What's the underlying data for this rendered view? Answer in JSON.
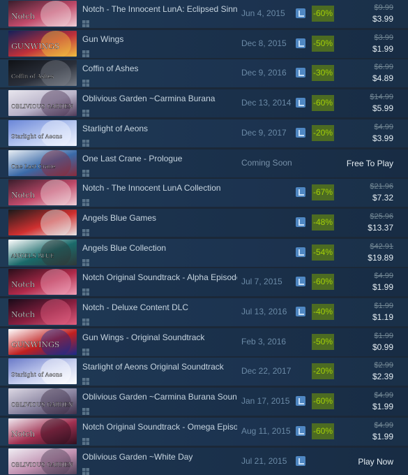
{
  "colors": {
    "background": "#1b2838",
    "discount_bg": "#4c6b22",
    "discount_text": "#a4d007",
    "wishlist_badge": "#4f87c2"
  },
  "rows": [
    {
      "title": "Notch - The Innocent LunA: Eclipsed Sinn...",
      "date": "Jun 4, 2015",
      "discount": "-60%",
      "original_price": "$9.99",
      "final_price": "$3.99",
      "capsule_text": "Notch",
      "capsule_colors": [
        "#3a1d2c",
        "#c04a6a",
        "#f0d0d8"
      ],
      "wishlist": true
    },
    {
      "title": "Gun Wings",
      "date": "Dec 8, 2015",
      "discount": "-50%",
      "original_price": "$3.99",
      "final_price": "$1.99",
      "capsule_text": "GUNWINGS",
      "capsule_colors": [
        "#14205a",
        "#c0303a",
        "#f0c040"
      ],
      "wishlist": true
    },
    {
      "title": "Coffin of Ashes",
      "date": "Dec 9, 2016",
      "discount": "-30%",
      "original_price": "$6.99",
      "final_price": "$4.89",
      "capsule_text": "Coffin of Ashes",
      "capsule_colors": [
        "#101216",
        "#2a2f3a",
        "#7a7f88"
      ],
      "wishlist": true
    },
    {
      "title": "Oblivious Garden ~Carmina Burana",
      "date": "Dec 13, 2014",
      "discount": "-60%",
      "original_price": "$14.99",
      "final_price": "$5.99",
      "capsule_text": "OBLIVIOUS GARDEN",
      "capsule_colors": [
        "#e8e6ee",
        "#b8b2c8",
        "#503a58"
      ],
      "wishlist": true
    },
    {
      "title": "Starlight of Aeons",
      "date": "Dec 9, 2017",
      "discount": "-20%",
      "original_price": "$4.99",
      "final_price": "$3.99",
      "capsule_text": "Starlight of Aeons",
      "capsule_colors": [
        "#6a86d8",
        "#b8c8f0",
        "#f0f4ff"
      ],
      "wishlist": true
    },
    {
      "title": "One Last Crane - Prologue",
      "date": "Coming Soon",
      "discount": "",
      "original_price": "",
      "final_price": "Free To Play",
      "capsule_text": "One Last Crane",
      "capsule_colors": [
        "#e8eef4",
        "#3a6aa8",
        "#8a2a3a"
      ],
      "wishlist": false
    },
    {
      "title": "Notch - The Innocent LunA Collection",
      "date": "",
      "discount": "-67%",
      "original_price": "$21.96",
      "final_price": "$7.32",
      "capsule_text": "Notch",
      "capsule_colors": [
        "#3a1d2c",
        "#c04a6a",
        "#f0d0d8"
      ],
      "wishlist": true
    },
    {
      "title": "Angels Blue Games",
      "date": "",
      "discount": "-48%",
      "original_price": "$25.96",
      "final_price": "$13.37",
      "capsule_text": "",
      "capsule_colors": [
        "#1a1a1a",
        "#d03030",
        "#e8e8e8"
      ],
      "wishlist": true
    },
    {
      "title": "Angels Blue Collection",
      "date": "",
      "discount": "-54%",
      "original_price": "$42.91",
      "final_price": "$19.89",
      "capsule_text": "ANGELS BLUE",
      "capsule_colors": [
        "#ffffff",
        "#1a6a6a",
        "#303838"
      ],
      "wishlist": true
    },
    {
      "title": "Notch Original Soundtrack - Alpha Episode",
      "date": "Jul 7, 2015",
      "discount": "-60%",
      "original_price": "$4.99",
      "final_price": "$1.99",
      "capsule_text": "Notch",
      "capsule_colors": [
        "#2a0e1a",
        "#b02a4a",
        "#f0a0b8"
      ],
      "wishlist": true
    },
    {
      "title": "Notch - Deluxe Content DLC",
      "date": "Jul 13, 2016",
      "discount": "-40%",
      "original_price": "$1.99",
      "final_price": "$1.19",
      "capsule_text": "Notch",
      "capsule_colors": [
        "#180a18",
        "#8a2040",
        "#e06080"
      ],
      "wishlist": true
    },
    {
      "title": "Gun Wings - Original Soundtrack",
      "date": "Feb 3, 2016",
      "discount": "-50%",
      "original_price": "$1.99",
      "final_price": "$0.99",
      "capsule_text": "GUNWINGS",
      "capsule_colors": [
        "#ffffff",
        "#c02020",
        "#1a2a8a"
      ],
      "wishlist": false
    },
    {
      "title": "Starlight of Aeons Original Soundtrack",
      "date": "Dec 22, 2017",
      "discount": "-20%",
      "original_price": "$2.99",
      "final_price": "$2.39",
      "capsule_text": "Starlight of Aeons",
      "capsule_colors": [
        "#6a7ac8",
        "#c8d0f0",
        "#ffffff"
      ],
      "wishlist": false
    },
    {
      "title": "Oblivious Garden ~Carmina Burana Soundt...",
      "date": "Jan 17, 2015",
      "discount": "-60%",
      "original_price": "$4.99",
      "final_price": "$1.99",
      "capsule_text": "OBLIVIOUS GARDEN",
      "capsule_colors": [
        "#dcd8e4",
        "#8a84a0",
        "#40304a"
      ],
      "wishlist": true
    },
    {
      "title": "Notch Original Soundtrack - Omega Episode",
      "date": "Aug 11, 2015",
      "discount": "-60%",
      "original_price": "$4.99",
      "final_price": "$1.99",
      "capsule_text": "Notch",
      "capsule_colors": [
        "#f0e8f0",
        "#a03050",
        "#301020"
      ],
      "wishlist": true
    },
    {
      "title": "Oblivious Garden ~White Day",
      "date": "Jul 21, 2015",
      "discount": "",
      "original_price": "",
      "final_price": "Play Now",
      "capsule_text": "OBLIVIOUS GARDEN",
      "capsule_colors": [
        "#f0eef4",
        "#c090b0",
        "#504058"
      ],
      "wishlist": true
    }
  ]
}
